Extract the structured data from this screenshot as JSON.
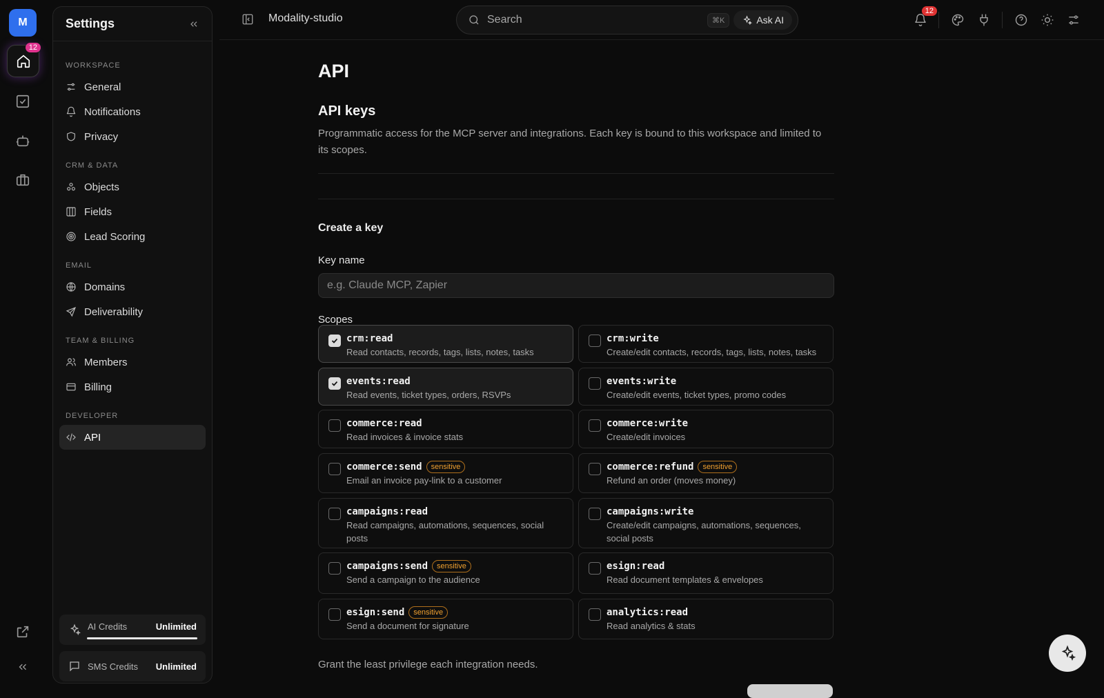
{
  "rail": {
    "avatar_letter": "M",
    "home_badge": "12",
    "items": [
      "home-icon",
      "tasks-icon",
      "bot-icon",
      "briefcase-icon",
      "external-link-icon",
      "collapse-icon"
    ]
  },
  "settings": {
    "title": "Settings",
    "sections": [
      {
        "label": "WORKSPACE",
        "items": [
          {
            "label": "General",
            "icon": "sliders-icon"
          },
          {
            "label": "Notifications",
            "icon": "bell-icon"
          },
          {
            "label": "Privacy",
            "icon": "shield-icon"
          }
        ]
      },
      {
        "label": "CRM & DATA",
        "items": [
          {
            "label": "Objects",
            "icon": "objects-icon"
          },
          {
            "label": "Fields",
            "icon": "columns-icon"
          },
          {
            "label": "Lead Scoring",
            "icon": "target-icon"
          }
        ]
      },
      {
        "label": "EMAIL",
        "items": [
          {
            "label": "Domains",
            "icon": "globe-icon"
          },
          {
            "label": "Deliverability",
            "icon": "send-icon"
          }
        ]
      },
      {
        "label": "TEAM & BILLING",
        "items": [
          {
            "label": "Members",
            "icon": "users-icon"
          },
          {
            "label": "Billing",
            "icon": "card-icon"
          }
        ]
      },
      {
        "label": "DEVELOPER",
        "items": [
          {
            "label": "API",
            "icon": "code-icon",
            "active": true
          }
        ]
      }
    ],
    "ai_credits": {
      "label": "AI Credits",
      "value": "Unlimited",
      "progress": 1.0
    },
    "sms_credits": {
      "label": "SMS Credits",
      "value": "Unlimited"
    }
  },
  "topbar": {
    "workspace": "Modality-studio",
    "search_placeholder": "Search",
    "shortcut": "⌘K",
    "ask_ai": "Ask AI",
    "notif_badge": "12"
  },
  "main": {
    "title": "API",
    "section_title": "API keys",
    "description": "Programmatic access for the MCP server and integrations. Each key is bound to this workspace and limited to its scopes.",
    "create_title": "Create a key",
    "key_name_label": "Key name",
    "key_name_placeholder": "e.g. Claude MCP, Zapier",
    "key_name_value": "",
    "scopes_label": "Scopes",
    "sensitive_label": "sensitive",
    "scopes": [
      {
        "name": "crm:read",
        "desc": "Read contacts, records, tags, lists, notes, tasks",
        "checked": true,
        "sensitive": false
      },
      {
        "name": "crm:write",
        "desc": "Create/edit contacts, records, tags, lists, notes, tasks",
        "checked": false,
        "sensitive": false
      },
      {
        "name": "events:read",
        "desc": "Read events, ticket types, orders, RSVPs",
        "checked": true,
        "sensitive": false
      },
      {
        "name": "events:write",
        "desc": "Create/edit events, ticket types, promo codes",
        "checked": false,
        "sensitive": false
      },
      {
        "name": "commerce:read",
        "desc": "Read invoices & invoice stats",
        "checked": false,
        "sensitive": false
      },
      {
        "name": "commerce:write",
        "desc": "Create/edit invoices",
        "checked": false,
        "sensitive": false
      },
      {
        "name": "commerce:send",
        "desc": "Email an invoice pay-link to a customer",
        "checked": false,
        "sensitive": true
      },
      {
        "name": "commerce:refund",
        "desc": "Refund an order (moves money)",
        "checked": false,
        "sensitive": true
      },
      {
        "name": "campaigns:read",
        "desc": "Read campaigns, automations, sequences, social posts",
        "checked": false,
        "sensitive": false
      },
      {
        "name": "campaigns:write",
        "desc": "Create/edit campaigns, automations, sequences, social posts",
        "checked": false,
        "sensitive": false
      },
      {
        "name": "campaigns:send",
        "desc": "Send a campaign to the audience",
        "checked": false,
        "sensitive": true
      },
      {
        "name": "esign:read",
        "desc": "Read document templates & envelopes",
        "checked": false,
        "sensitive": false
      },
      {
        "name": "esign:send",
        "desc": "Send a document for signature",
        "checked": false,
        "sensitive": true
      },
      {
        "name": "analytics:read",
        "desc": "Read analytics & stats",
        "checked": false,
        "sensitive": false
      }
    ],
    "hint": "Grant the least privilege each integration needs."
  }
}
